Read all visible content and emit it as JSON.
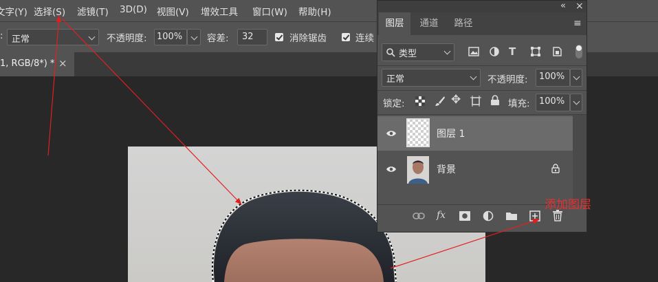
{
  "menu": {
    "items": [
      "文字(Y)",
      "选择(S)",
      "滤镜(T)",
      "3D(D)",
      "视图(V)",
      "增效工具",
      "窗口(W)",
      "帮助(H)"
    ]
  },
  "options": {
    "mode_prefix": ":",
    "mode_value": "正常",
    "opacity_label": "不透明度:",
    "opacity_value": "100%",
    "tolerance_label": "容差:",
    "tolerance_value": "32",
    "antialias_label": "消除锯齿",
    "contiguous_label": "连续"
  },
  "document_tab": {
    "title": "1, RGB/8*) *",
    "close": "×"
  },
  "layers_panel": {
    "collapse_glyph": "«",
    "close_glyph": "×",
    "tabs": [
      "图层",
      "通道",
      "路径"
    ],
    "active_tab": "图层",
    "menu_glyph": "≡",
    "filter_kind": "类型",
    "blend_mode": "正常",
    "opacity_label": "不透明度:",
    "opacity_value": "100%",
    "lock_label": "锁定:",
    "fill_label": "填充:",
    "fill_value": "100%",
    "layers": [
      {
        "name": "图层 1",
        "visible": true,
        "selected": true,
        "thumbnail": "transparent-checker"
      },
      {
        "name": "背景",
        "visible": true,
        "selected": false,
        "thumbnail": "portrait",
        "locked": true
      }
    ],
    "footer_icons": [
      "link-icon",
      "fx-icon",
      "mask-icon",
      "adjustment-icon",
      "folder-icon",
      "new-layer-icon",
      "trash-icon"
    ],
    "fx_label": "fx"
  },
  "annotation": {
    "text": "添加图层",
    "color": "#e83030"
  },
  "colors": {
    "ui_panel": "#535353",
    "canvas_bg": "#282828",
    "arrow_red": "#e02020"
  }
}
